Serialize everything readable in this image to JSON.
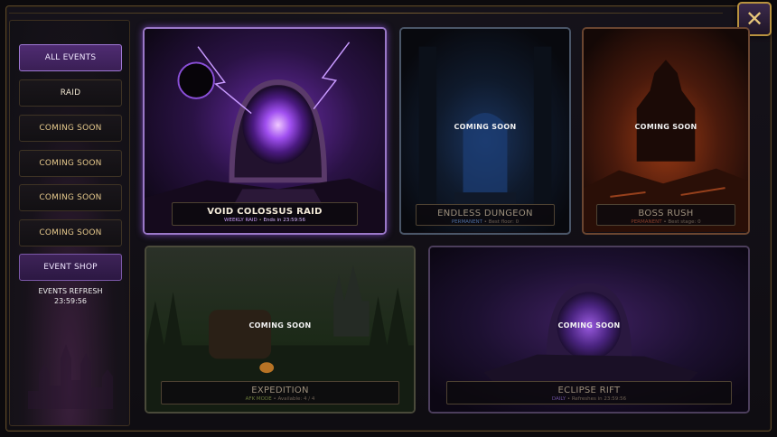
{
  "close_icon": "✕",
  "sidebar": {
    "items": [
      {
        "label": "ALL EVENTS",
        "state": "active"
      },
      {
        "label": "RAID",
        "state": "normal"
      },
      {
        "label": "COMING SOON",
        "state": "normal"
      },
      {
        "label": "COMING SOON",
        "state": "normal"
      },
      {
        "label": "COMING SOON",
        "state": "normal"
      },
      {
        "label": "COMING SOON",
        "state": "normal"
      }
    ],
    "shop": {
      "label": "EVENT SHOP"
    },
    "refresh": {
      "label": "EVENTS REFRESH",
      "timer": "23:59:56"
    }
  },
  "events": [
    {
      "title": "VOID COLOSSUS RAID",
      "subtitle_a": "WEEKLY RAID",
      "subtitle_b": "Ends in 23:59:56",
      "available": true,
      "accent": "#a86ef0"
    },
    {
      "title": "ENDLESS DUNGEON",
      "subtitle_a": "PERMANENT",
      "subtitle_b": "Best floor: 0",
      "available": false,
      "overlay": "COMING SOON",
      "accent": "#3a6ec8"
    },
    {
      "title": "BOSS RUSH",
      "subtitle_a": "PERMANENT",
      "subtitle_b": "Best stage: 0",
      "available": false,
      "overlay": "COMING SOON",
      "accent": "#e0622a"
    },
    {
      "title": "EXPEDITION",
      "subtitle_a": "AFK MODE",
      "subtitle_b": "Available: 4 / 4",
      "available": false,
      "overlay": "COMING SOON",
      "accent": "#6e8a3a"
    },
    {
      "title": "ECLIPSE RIFT",
      "subtitle_a": "DAILY",
      "subtitle_b": "Refreshes in 23:59:56",
      "available": false,
      "overlay": "COMING SOON",
      "accent": "#7a4ed0"
    }
  ]
}
